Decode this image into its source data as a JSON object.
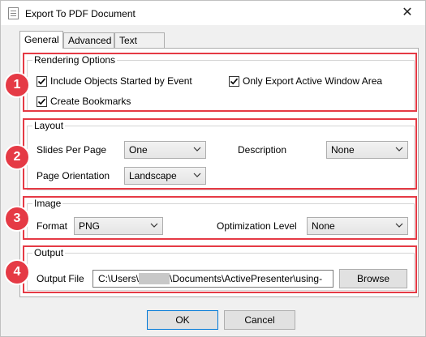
{
  "window": {
    "title": "Export To PDF Document",
    "close_glyph": "✕"
  },
  "tabs": [
    {
      "label": "General",
      "active": true
    },
    {
      "label": "Advanced",
      "active": false
    },
    {
      "label": "Text Style",
      "active": false
    }
  ],
  "rendering": {
    "title": "Rendering Options",
    "include_objects": {
      "label": "Include Objects Started by Event",
      "checked": true
    },
    "only_export": {
      "label": "Only Export Active Window Area",
      "checked": true
    },
    "bookmarks": {
      "label": "Create Bookmarks",
      "checked": true
    }
  },
  "layout": {
    "title": "Layout",
    "slides_per_page": {
      "label": "Slides Per Page",
      "value": "One"
    },
    "description": {
      "label": "Description",
      "value": "None"
    },
    "orientation": {
      "label": "Page Orientation",
      "value": "Landscape"
    }
  },
  "image": {
    "title": "Image",
    "format": {
      "label": "Format",
      "value": "PNG"
    },
    "optimization": {
      "label": "Optimization Level",
      "value": "None"
    }
  },
  "output": {
    "title": "Output",
    "file_label": "Output File",
    "path_prefix": "C:\\Users\\",
    "path_suffix": "\\Documents\\ActivePresenter\\using-",
    "browse": "Browse"
  },
  "badges": [
    "1",
    "2",
    "3",
    "4"
  ],
  "buttons": {
    "ok": "OK",
    "cancel": "Cancel"
  },
  "colors": {
    "highlight": "#e53a45",
    "dialog_bg": "#f0f0f0"
  }
}
